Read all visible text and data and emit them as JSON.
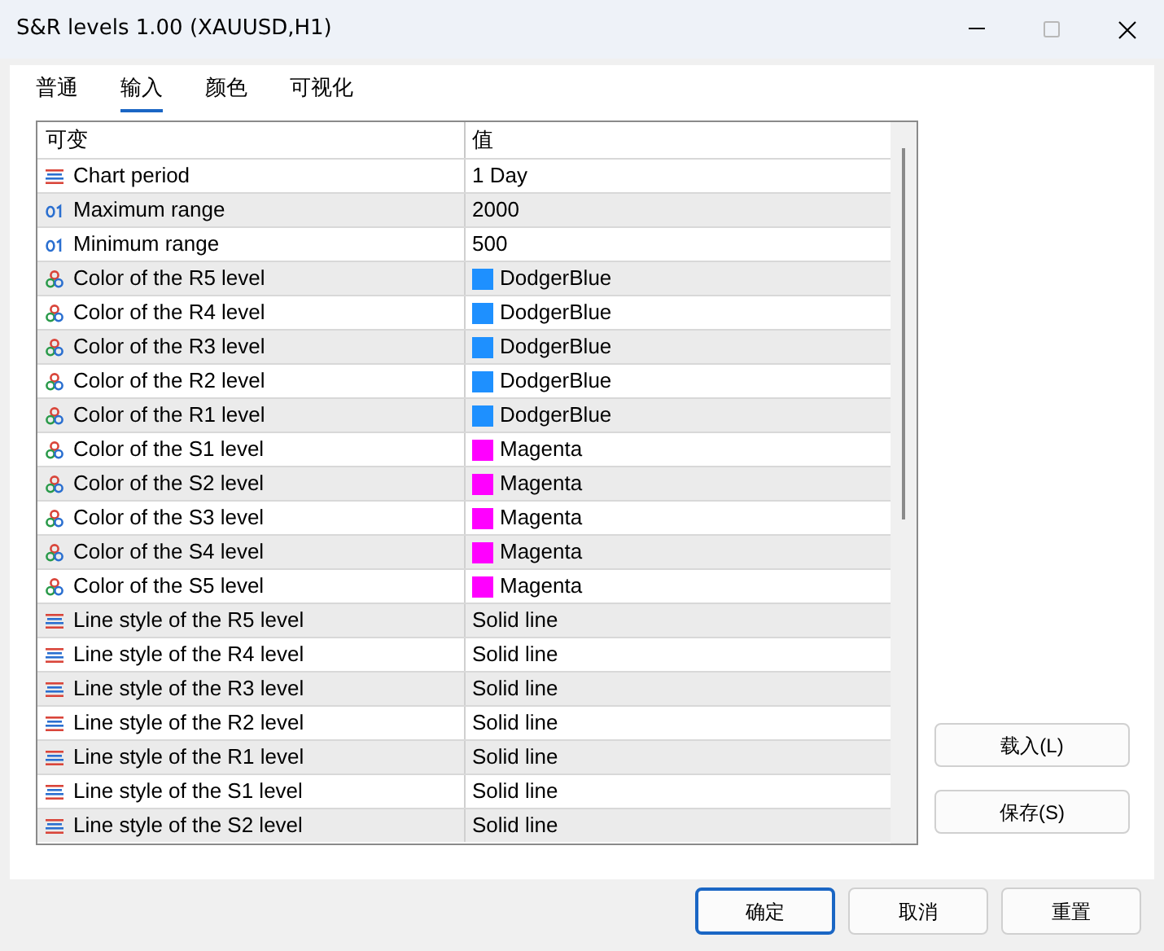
{
  "window": {
    "title": "S&R levels 1.00 (XAUUSD,H1)",
    "maximize_disabled": true
  },
  "tabs": [
    {
      "label": "普通",
      "selected": false
    },
    {
      "label": "输入",
      "selected": true
    },
    {
      "label": "颜色",
      "selected": false
    },
    {
      "label": "可视化",
      "selected": false
    }
  ],
  "table": {
    "columns": [
      "可变",
      "值"
    ],
    "rows": [
      {
        "kind": "enum",
        "name": "Chart period",
        "value": "1 Day"
      },
      {
        "kind": "int",
        "name": "Maximum range",
        "value": "2000"
      },
      {
        "kind": "int",
        "name": "Minimum range",
        "value": "500"
      },
      {
        "kind": "color",
        "name": "Color of the R5 level",
        "value": "DodgerBlue",
        "color": "#1e90ff"
      },
      {
        "kind": "color",
        "name": "Color of the R4 level",
        "value": "DodgerBlue",
        "color": "#1e90ff"
      },
      {
        "kind": "color",
        "name": "Color of the R3 level",
        "value": "DodgerBlue",
        "color": "#1e90ff"
      },
      {
        "kind": "color",
        "name": "Color of the R2 level",
        "value": "DodgerBlue",
        "color": "#1e90ff"
      },
      {
        "kind": "color",
        "name": "Color of the R1 level",
        "value": "DodgerBlue",
        "color": "#1e90ff"
      },
      {
        "kind": "color",
        "name": "Color of the S1 level",
        "value": "Magenta",
        "color": "#ff00ff"
      },
      {
        "kind": "color",
        "name": "Color of the S2 level",
        "value": "Magenta",
        "color": "#ff00ff"
      },
      {
        "kind": "color",
        "name": "Color of the S3 level",
        "value": "Magenta",
        "color": "#ff00ff"
      },
      {
        "kind": "color",
        "name": "Color of the S4 level",
        "value": "Magenta",
        "color": "#ff00ff"
      },
      {
        "kind": "color",
        "name": "Color of the S5 level",
        "value": "Magenta",
        "color": "#ff00ff"
      },
      {
        "kind": "enum",
        "name": "Line style of the R5 level",
        "value": "Solid line"
      },
      {
        "kind": "enum",
        "name": "Line style of the R4 level",
        "value": "Solid line"
      },
      {
        "kind": "enum",
        "name": "Line style of the R3 level",
        "value": "Solid line"
      },
      {
        "kind": "enum",
        "name": "Line style of the R2 level",
        "value": "Solid line"
      },
      {
        "kind": "enum",
        "name": "Line style of the R1 level",
        "value": "Solid line"
      },
      {
        "kind": "enum",
        "name": "Line style of the S1 level",
        "value": "Solid line"
      },
      {
        "kind": "enum",
        "name": "Line style of the S2 level",
        "value": "Solid line"
      }
    ]
  },
  "side_buttons": [
    "载入(L)",
    "保存(S)"
  ],
  "footer_buttons": [
    {
      "label": "确定",
      "selected": true
    },
    {
      "label": "取消",
      "selected": false
    },
    {
      "label": "重置",
      "selected": false
    }
  ]
}
